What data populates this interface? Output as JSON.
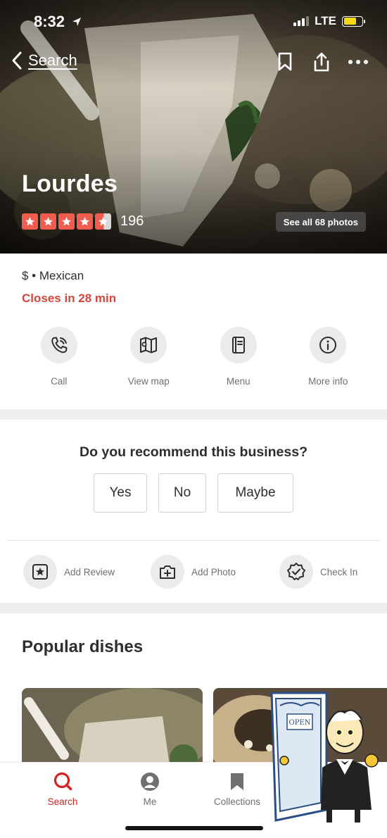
{
  "status_bar": {
    "time": "8:32",
    "network": "LTE"
  },
  "nav": {
    "back_label": "Search"
  },
  "business": {
    "name": "Lourdes",
    "rating": 4.5,
    "rating_max": 5,
    "review_count": "196",
    "see_photos_label": "See all 68 photos",
    "price_category": "$ • Mexican",
    "hours_status": "Closes in 28 min"
  },
  "actions": [
    {
      "label": "Call",
      "icon": "phone-icon"
    },
    {
      "label": "View map",
      "icon": "map-icon"
    },
    {
      "label": "Menu",
      "icon": "menu-book-icon"
    },
    {
      "label": "More info",
      "icon": "info-icon"
    }
  ],
  "recommend": {
    "question": "Do you recommend this business?",
    "options": [
      "Yes",
      "No",
      "Maybe"
    ]
  },
  "quick_actions": [
    {
      "label": "Add Review",
      "icon": "star-box-icon"
    },
    {
      "label": "Add Photo",
      "icon": "add-photo-icon"
    },
    {
      "label": "Check In",
      "icon": "check-badge-icon"
    }
  ],
  "popular": {
    "title": "Popular dishes"
  },
  "sticker": {
    "text": "OPEN"
  },
  "tabs": [
    {
      "label": "Search",
      "icon": "search-icon",
      "active": true
    },
    {
      "label": "Me",
      "icon": "profile-icon",
      "active": false
    },
    {
      "label": "Collections",
      "icon": "bookmark-icon",
      "active": false
    }
  ],
  "colors": {
    "brand_red": "#d32323",
    "star_red": "#f15c4f",
    "closing_red": "#d9453b"
  }
}
